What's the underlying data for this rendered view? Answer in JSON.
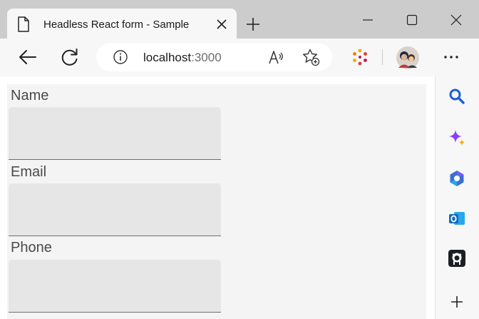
{
  "browser": {
    "tab_title": "Headless React form - Sample",
    "url_host": "localhost",
    "url_port": ":3000"
  },
  "icons": {
    "tab": "document-icon",
    "tab_close": "close-icon",
    "new_tab": "plus-icon",
    "minimize": "minimize-icon",
    "maximize": "maximize-icon",
    "close_window": "close-icon",
    "back": "back-arrow-icon",
    "refresh": "refresh-icon",
    "site_info": "info-icon",
    "read_aloud": "read-aloud-icon",
    "favorites": "add-favorite-icon",
    "extension": "extension-icon",
    "profile": "avatar",
    "menu": "more-icon"
  },
  "sidebar": {
    "items": [
      "search-icon",
      "copilot-icon",
      "microsoft365-icon",
      "outlook-icon",
      "github-icon",
      "add-icon"
    ],
    "colors": {
      "search": "#1f5fd6",
      "copilot": "#8a3ffc",
      "m365": "#3b6fd4",
      "outlook": "#0f6cbd",
      "github": "#1b1f24"
    }
  },
  "form": {
    "fields": [
      {
        "label": "Name"
      },
      {
        "label": "Email"
      },
      {
        "label": "Phone"
      }
    ]
  }
}
